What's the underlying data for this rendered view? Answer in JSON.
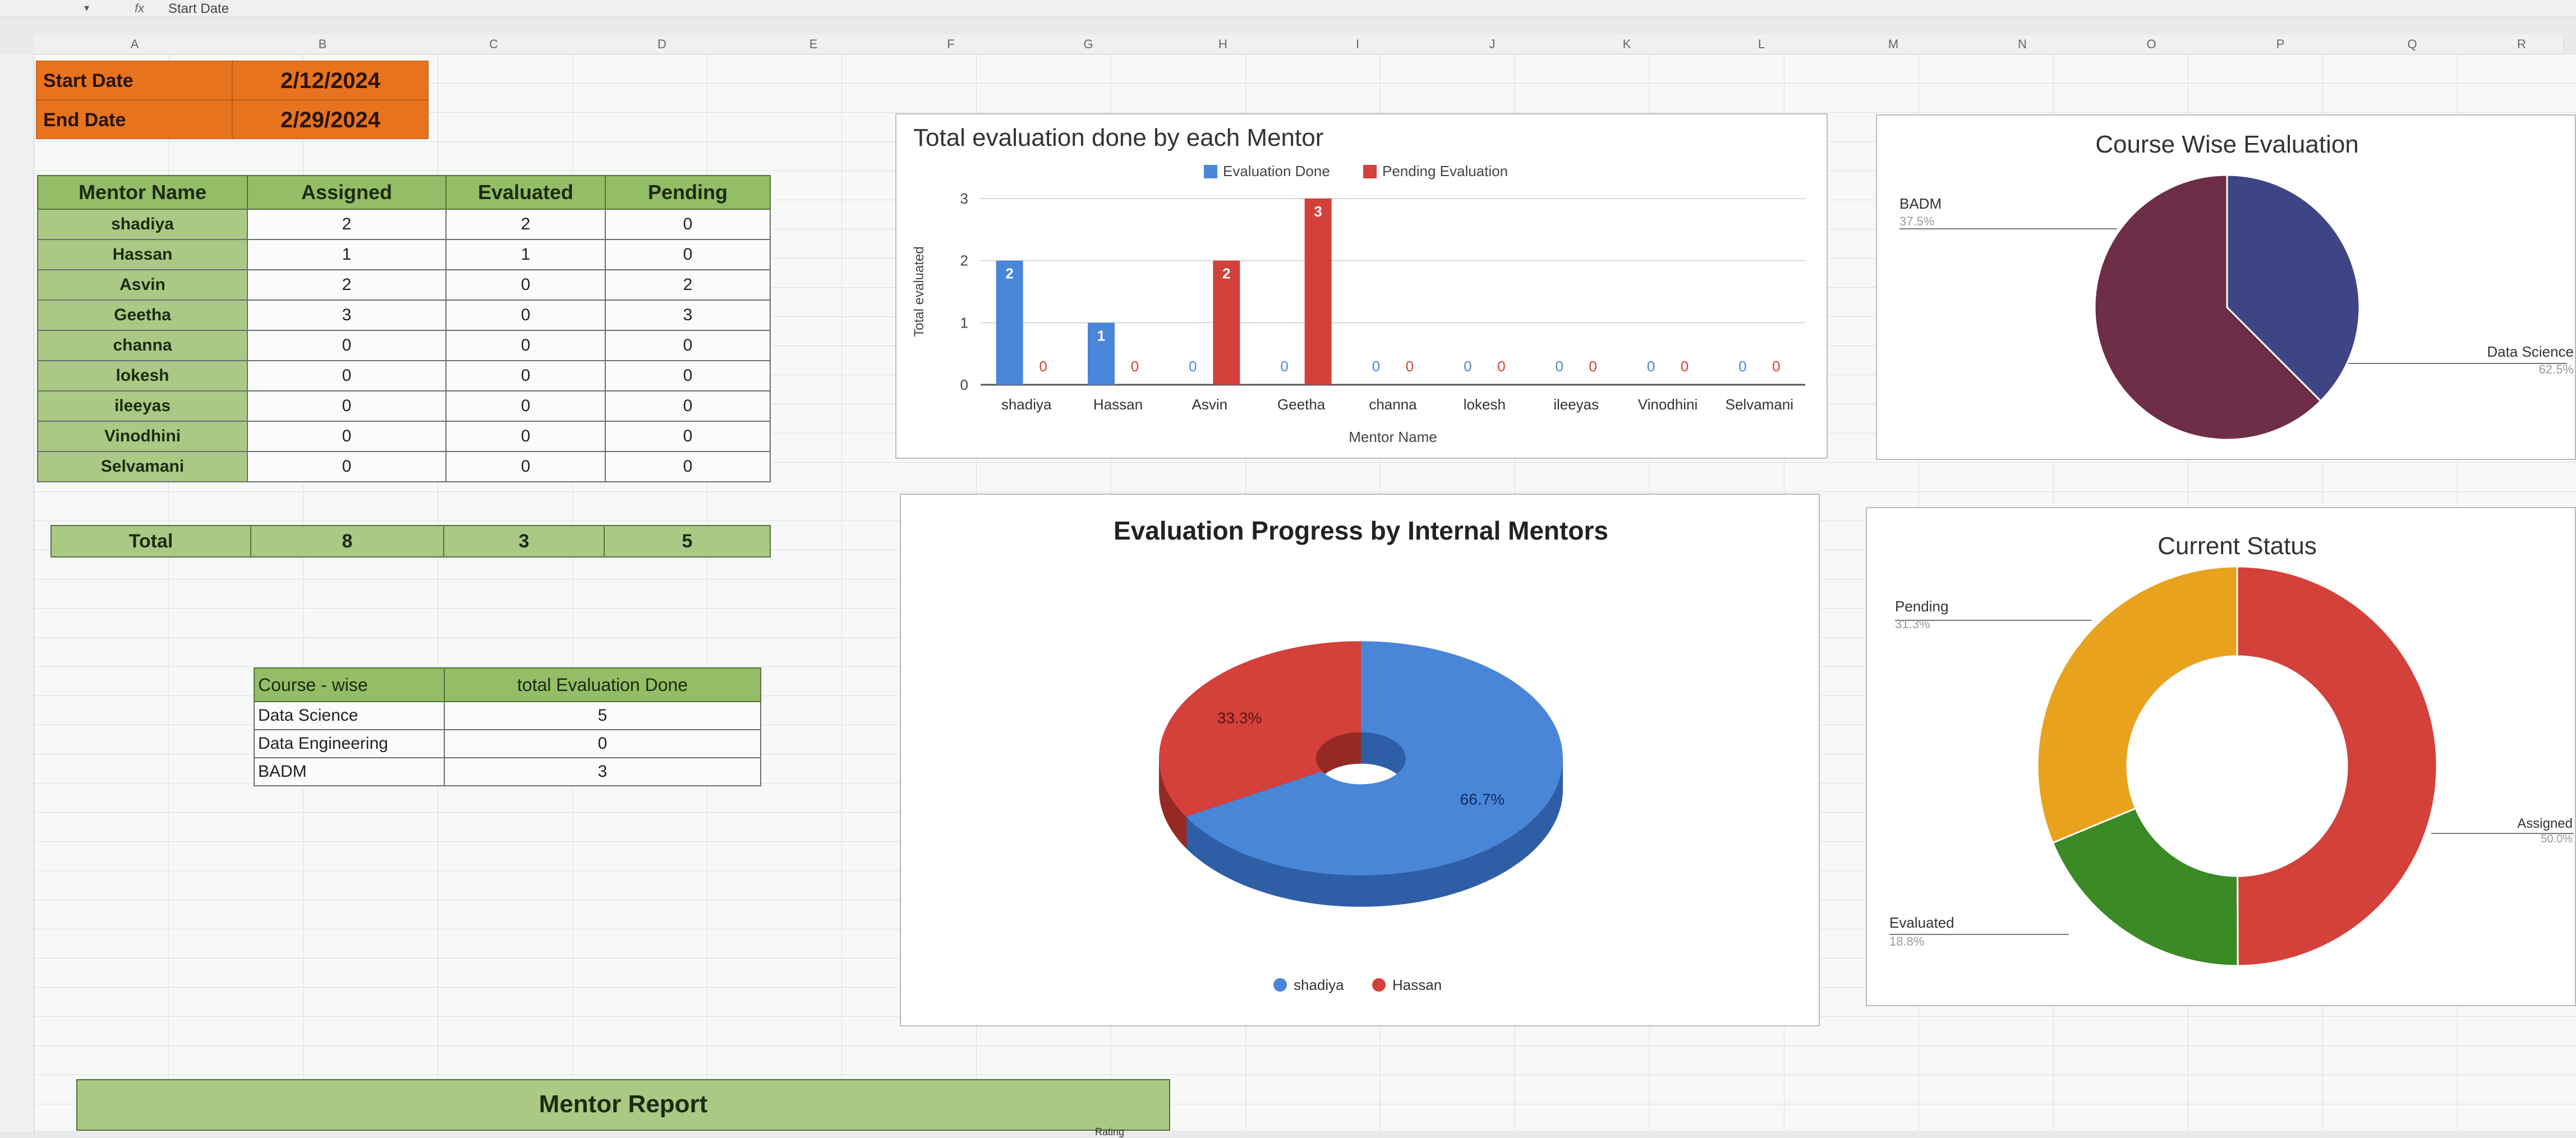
{
  "formula_bar": {
    "dropdown_icon": "caret-down-icon",
    "fx_label": "fx",
    "content": "Start Date"
  },
  "columns": [
    "A",
    "B",
    "C",
    "D",
    "E",
    "F",
    "G",
    "H",
    "I",
    "J",
    "K",
    "L",
    "M",
    "N",
    "O",
    "P",
    "Q",
    "R"
  ],
  "dates": {
    "start_label": "Start Date",
    "start_value": "2/12/2024",
    "end_label": "End Date",
    "end_value": "2/29/2024"
  },
  "mentor_table": {
    "headers": [
      "Mentor Name",
      "Assigned",
      "Evaluated",
      "Pending"
    ],
    "rows": [
      {
        "name": "shadiya",
        "assigned": "2",
        "evaluated": "2",
        "pending": "0"
      },
      {
        "name": "Hassan",
        "assigned": "1",
        "evaluated": "1",
        "pending": "0"
      },
      {
        "name": "Asvin",
        "assigned": "2",
        "evaluated": "0",
        "pending": "2"
      },
      {
        "name": "Geetha",
        "assigned": "3",
        "evaluated": "0",
        "pending": "3"
      },
      {
        "name": "channa",
        "assigned": "0",
        "evaluated": "0",
        "pending": "0"
      },
      {
        "name": "lokesh",
        "assigned": "0",
        "evaluated": "0",
        "pending": "0"
      },
      {
        "name": "ileeyas",
        "assigned": "0",
        "evaluated": "0",
        "pending": "0"
      },
      {
        "name": "Vinodhini",
        "assigned": "0",
        "evaluated": "0",
        "pending": "0"
      },
      {
        "name": "Selvamani",
        "assigned": "0",
        "evaluated": "0",
        "pending": "0"
      }
    ]
  },
  "totals": {
    "label": "Total",
    "assigned": "8",
    "evaluated": "3",
    "pending": "5"
  },
  "course_table": {
    "headers": [
      "Course - wise",
      "total Evaluation Done"
    ],
    "rows": [
      {
        "course": "Data Science",
        "value": "5"
      },
      {
        "course": "Data Engineering",
        "value": "0"
      },
      {
        "course": "BADM",
        "value": "3"
      }
    ]
  },
  "mentor_report": {
    "title": "Mentor Report",
    "sub": "Rating"
  },
  "colors": {
    "blue": "#4a86d8",
    "red": "#d4403a",
    "orange": "#e8a21e",
    "green": "#3a8a26",
    "navy": "#3e4585",
    "maroon": "#6e2e47",
    "header_green": "#93bd66",
    "date_orange": "#e8731f"
  },
  "chart_data": [
    {
      "type": "bar",
      "title": "Total evaluation done by each Mentor",
      "xlabel": "Mentor Name",
      "ylabel": "Total evaluated",
      "ylim": [
        0,
        3
      ],
      "yticks": [
        "0",
        "1",
        "2",
        "3"
      ],
      "legend_position": "top",
      "categories": [
        "shadiya",
        "Hassan",
        "Asvin",
        "Geetha",
        "channa",
        "lokesh",
        "ileeyas",
        "Vinodhini",
        "Selvamani"
      ],
      "series": [
        {
          "name": "Evaluation Done",
          "color": "#4a86d8",
          "values": [
            2,
            1,
            0,
            0,
            0,
            0,
            0,
            0,
            0
          ]
        },
        {
          "name": "Pending Evaluation",
          "color": "#d4403a",
          "values": [
            0,
            0,
            2,
            3,
            0,
            0,
            0,
            0,
            0
          ]
        }
      ]
    },
    {
      "type": "pie",
      "title": "Course Wise Evaluation",
      "slices": [
        {
          "label": "BADM",
          "value": 37.5,
          "pct": "37.5%",
          "color": "#3e4585"
        },
        {
          "label": "Data Science",
          "value": 62.5,
          "pct": "62.5%",
          "color": "#6e2e47"
        }
      ]
    },
    {
      "type": "pie",
      "title": "Evaluation Progress by Internal Mentors",
      "legend_position": "bottom",
      "slices": [
        {
          "label": "shadiya",
          "value": 66.7,
          "pct": "66.7%",
          "color": "#4a86d8"
        },
        {
          "label": "Hassan",
          "value": 33.3,
          "pct": "33.3%",
          "color": "#d4403a"
        }
      ]
    },
    {
      "type": "pie",
      "title": "Current Status",
      "slices": [
        {
          "label": "Assigned",
          "value": 50.0,
          "pct": "50.0%",
          "color": "#d4403a"
        },
        {
          "label": "Evaluated",
          "value": 18.8,
          "pct": "18.8%",
          "color": "#3a8a26"
        },
        {
          "label": "Pending",
          "value": 31.3,
          "pct": "31.3%",
          "color": "#e8a21e"
        }
      ]
    }
  ]
}
